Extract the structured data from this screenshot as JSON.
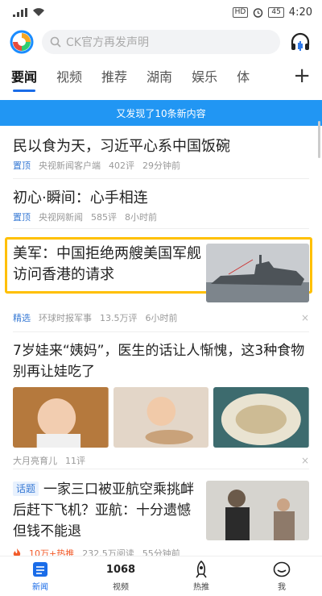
{
  "status": {
    "carrier_signal": "4G",
    "hd": "HD",
    "battery": "45",
    "time": "4:20"
  },
  "header": {
    "search_placeholder": "CK官方再发声明",
    "logo_icon": "tencent-news-logo",
    "listen_icon": "headphones-icon"
  },
  "tabs": [
    {
      "label": "要闻",
      "active": true
    },
    {
      "label": "视频"
    },
    {
      "label": "推荐"
    },
    {
      "label": "湖南"
    },
    {
      "label": "娱乐"
    },
    {
      "label": "体"
    }
  ],
  "tabs_plus": "+",
  "banner": "又发现了10条新内容",
  "news": [
    {
      "title": "民以食为天，习近平心系中国饭碗",
      "tag": "置顶",
      "source": "央视新闻客户端",
      "comments": "402评",
      "time": "29分钟前"
    },
    {
      "title": "初心·瞬间：心手相连",
      "tag": "置顶",
      "source": "央视网新闻",
      "comments": "585评",
      "time": "8小时前"
    },
    {
      "title": "美军：中国拒绝两艘美国军舰访问香港的请求",
      "tag": "精选",
      "source": "环球时报军事",
      "comments": "13.5万评",
      "time": "6小时前"
    },
    {
      "title": "7岁娃来“姨妈”，医生的话让人惭愧，这3种食物别再让娃吃了",
      "source": "大月亮育儿",
      "comments": "11评"
    },
    {
      "badge": "话题",
      "title": "一家三口被亚航空乘挑衅后赶下飞机？亚航：十分遗憾 但钱不能退",
      "hot": "10万+热推",
      "reads": "232.5万阅读",
      "time": "55分钟前"
    }
  ],
  "close": "×",
  "bottom_nav": [
    {
      "label": "新闻",
      "active": true
    },
    {
      "label": "视频",
      "icon_text": "1068"
    },
    {
      "label": "热推"
    },
    {
      "label": "我"
    }
  ],
  "colors": {
    "accent": "#1a6ce8",
    "banner": "#2196f3",
    "highlight": "#ffc000",
    "hot": "#f25b2a"
  }
}
